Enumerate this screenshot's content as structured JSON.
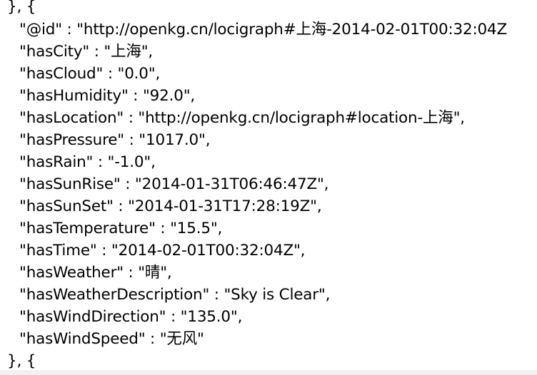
{
  "json_viewer": {
    "lines": [
      "}, {",
      "\"@id\" : \"http://openkg.cn/locigraph#上海-2014-02-01T00:32:04Z",
      "\"hasCity\" : \"上海\",",
      "\"hasCloud\" : \"0.0\",",
      "\"hasHumidity\" : \"92.0\",",
      "\"hasLocation\" : \"http://openkg.cn/locigraph#location-上海\",",
      "\"hasPressure\" : \"1017.0\",",
      "\"hasRain\" : \"-1.0\",",
      "\"hasSunRise\" : \"2014-01-31T06:46:47Z\",",
      "\"hasSunSet\" : \"2014-01-31T17:28:19Z\",",
      "\"hasTemperature\" : \"15.5\",",
      "\"hasTime\" : \"2014-02-01T00:32:04Z\",",
      "\"hasWeather\" : \"晴\",",
      "\"hasWeatherDescription\" : \"Sky is Clear\",",
      "\"hasWindDirection\" : \"135.0\",",
      "\"hasWindSpeed\" : \"无风\"",
      "}, {"
    ]
  }
}
